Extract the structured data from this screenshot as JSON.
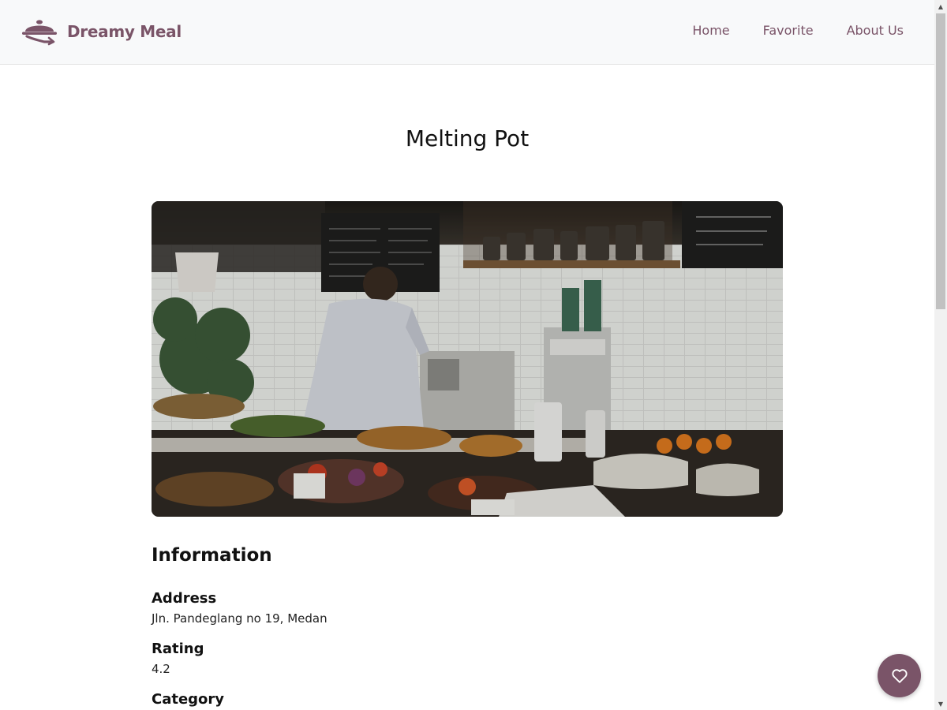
{
  "header": {
    "brand_name": "Dreamy Meal",
    "logo_icon": "cloche-icon",
    "nav": [
      {
        "label": "Home"
      },
      {
        "label": "Favorite"
      },
      {
        "label": "About Us"
      }
    ]
  },
  "restaurant": {
    "name": "Melting Pot",
    "image_alt": "Café counter with barista working behind a display of food"
  },
  "information": {
    "heading": "Information",
    "address": {
      "label": "Address",
      "value": "Jln. Pandeglang no 19, Medan"
    },
    "rating": {
      "label": "Rating",
      "value": "4.2"
    },
    "category": {
      "label": "Category"
    }
  },
  "favorite_button": {
    "icon": "heart-icon"
  },
  "colors": {
    "brand": "#7a5468",
    "header_bg": "#f8f9fa",
    "text": "#111111"
  }
}
